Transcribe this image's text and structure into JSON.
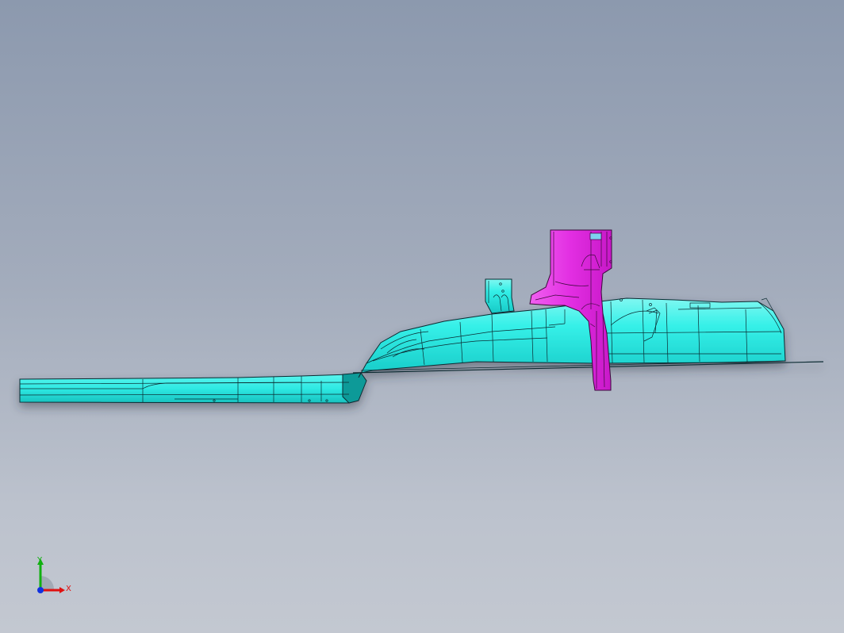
{
  "view": {
    "background_top": "#8c99ae",
    "background_bottom": "#c3c8d1",
    "part_color": "#33f2ea",
    "bracket_color": "#e830e8",
    "edge_color": "#0a2a30"
  },
  "triad": {
    "x_label": "X",
    "y_label": "Y",
    "x_color": "#e01010",
    "y_color": "#10b010",
    "z_color": "#1030e0"
  }
}
